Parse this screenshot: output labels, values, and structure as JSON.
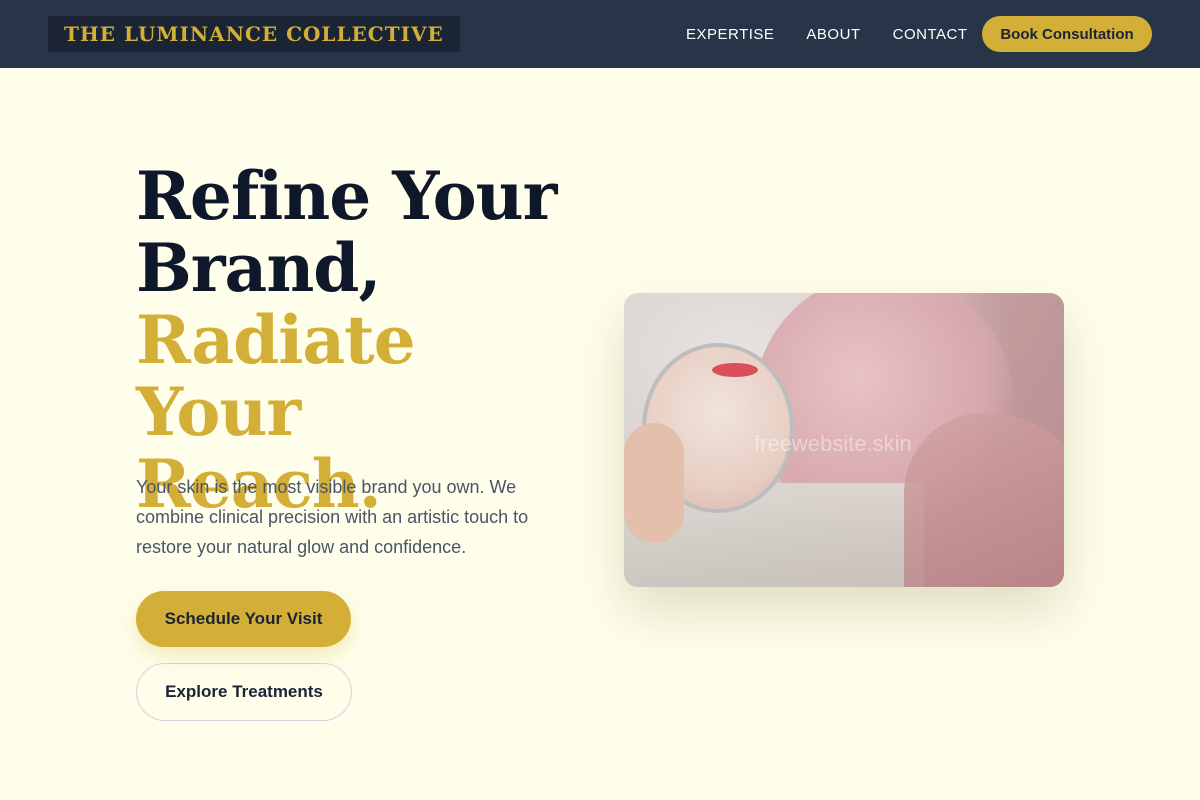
{
  "brand": {
    "logo": "THE LUMINANCE COLLECTIVE"
  },
  "nav": {
    "links": [
      "EXPERTISE",
      "ABOUT",
      "CONTACT"
    ],
    "cta": "Book Consultation"
  },
  "hero": {
    "title_lines": [
      "Refine Your",
      "Brand,"
    ],
    "title_accent_lines": [
      "Radiate Your",
      "Reach."
    ],
    "description": "Your skin is the most visible brand you own. We combine clinical precision with an artistic touch to restore your natural glow and confidence.",
    "primary_button": "Schedule Your Visit",
    "secondary_button": "Explore Treatments",
    "image_watermark": "freewebsite.skin"
  },
  "colors": {
    "accent": "#d4af37",
    "nav_background": "#283548",
    "page_background": "#fefeeb",
    "heading": "#0f172a"
  }
}
